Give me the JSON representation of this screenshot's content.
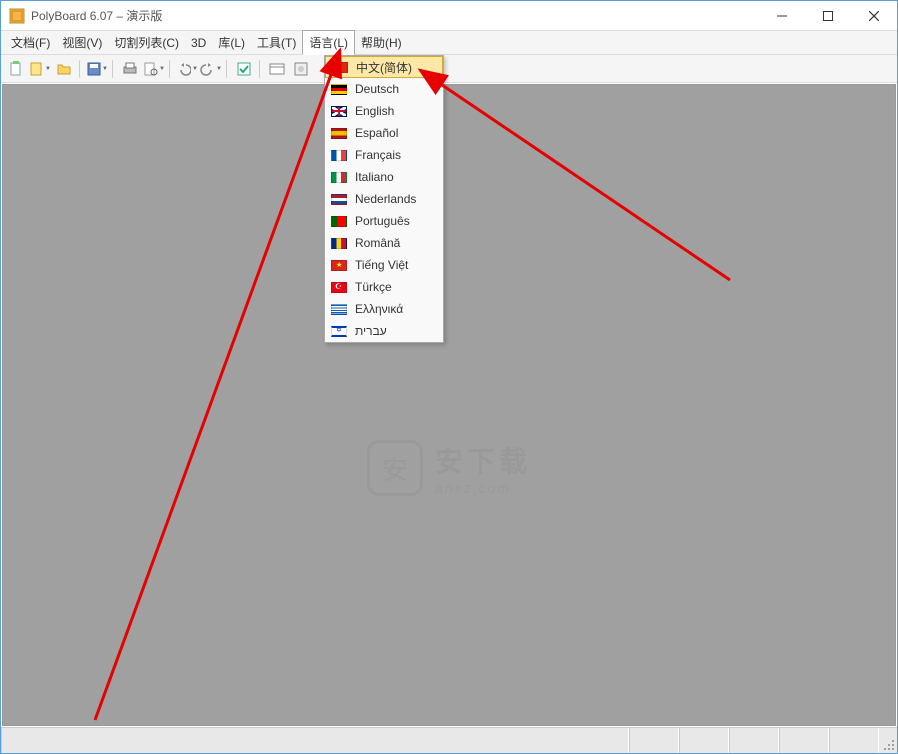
{
  "title": "PolyBoard 6.07 – 演示版",
  "menus": [
    {
      "label": "文档",
      "key": "(F)"
    },
    {
      "label": "视图",
      "key": "(V)"
    },
    {
      "label": "切割列表",
      "key": "(C)"
    },
    {
      "label": "3D",
      "key": ""
    },
    {
      "label": "库",
      "key": "(L)"
    },
    {
      "label": "工具",
      "key": "(T)"
    },
    {
      "label": "语言",
      "key": "(L)",
      "active": true
    },
    {
      "label": "帮助",
      "key": "(H)"
    }
  ],
  "languages": [
    {
      "label": "中文(简体)",
      "flag": "cn",
      "hl": true
    },
    {
      "label": "Deutsch",
      "flag": "de"
    },
    {
      "label": "English",
      "flag": "en"
    },
    {
      "label": "Español",
      "flag": "es"
    },
    {
      "label": "Français",
      "flag": "fr"
    },
    {
      "label": "Italiano",
      "flag": "it"
    },
    {
      "label": "Nederlands",
      "flag": "nl"
    },
    {
      "label": "Português",
      "flag": "pt"
    },
    {
      "label": "Română",
      "flag": "ro"
    },
    {
      "label": "Tiếng Việt",
      "flag": "vn"
    },
    {
      "label": "Türkçe",
      "flag": "tr"
    },
    {
      "label": "Ελληνικά",
      "flag": "gr"
    },
    {
      "label": "עברית",
      "flag": "il"
    }
  ],
  "watermark": {
    "big": "安下载",
    "small": "anxz.com"
  }
}
